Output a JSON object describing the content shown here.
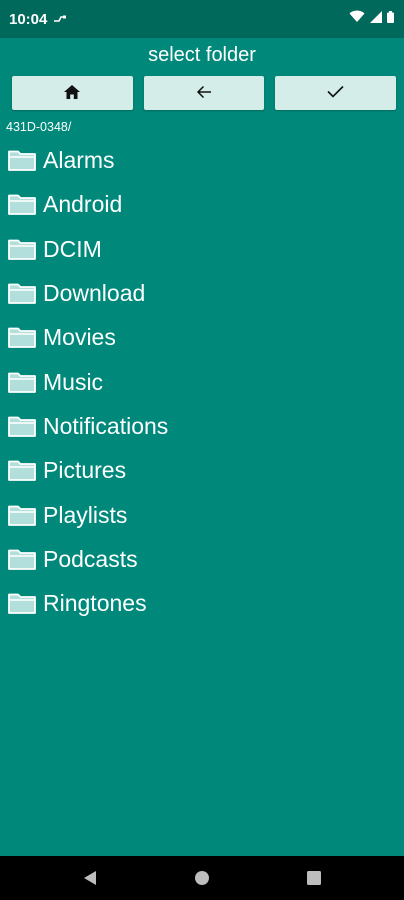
{
  "status_bar": {
    "time": "10:04"
  },
  "header": {
    "title": "select folder"
  },
  "toolbar": {
    "home_icon": "home-icon",
    "back_icon": "arrow-back-icon",
    "confirm_icon": "check-icon"
  },
  "path": "431D-0348/",
  "folders": [
    {
      "name": "Alarms"
    },
    {
      "name": "Android"
    },
    {
      "name": "DCIM"
    },
    {
      "name": "Download"
    },
    {
      "name": "Movies"
    },
    {
      "name": "Music"
    },
    {
      "name": "Notifications"
    },
    {
      "name": "Pictures"
    },
    {
      "name": "Playlists"
    },
    {
      "name": "Podcasts"
    },
    {
      "name": "Ringtones"
    }
  ],
  "colors": {
    "background": "#00897b",
    "status_bar": "#00695c",
    "button": "#d5ede8",
    "folder_fill": "#b2dfdb"
  }
}
